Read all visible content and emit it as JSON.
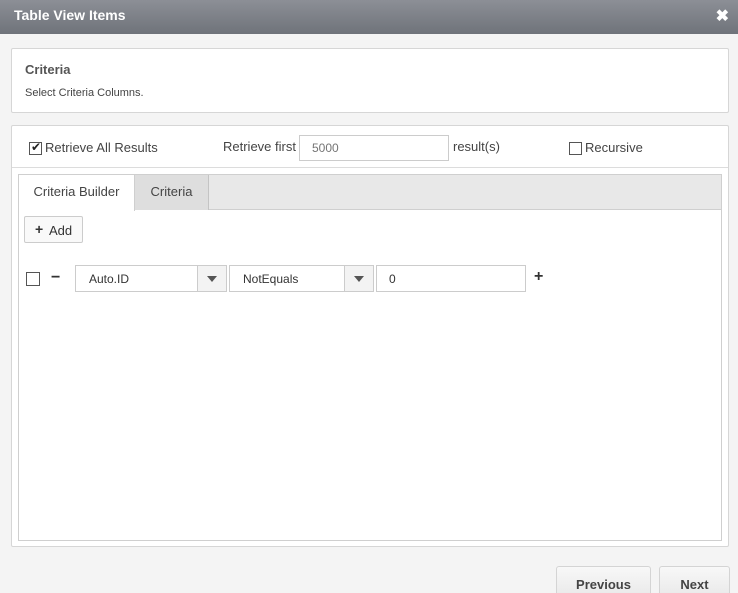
{
  "window": {
    "title": "Table View Items",
    "close_icon": "✖"
  },
  "criteria_panel": {
    "heading": "Criteria",
    "description": "Select Criteria Columns."
  },
  "options": {
    "retrieve_all_label": "Retrieve All Results",
    "retrieve_all_checked": true,
    "retrieve_first_label": "Retrieve first",
    "retrieve_first_placeholder": "5000",
    "results_suffix": "result(s)",
    "recursive_label": "Recursive",
    "recursive_checked": false
  },
  "tabs": [
    {
      "label": "Criteria Builder",
      "active": true
    },
    {
      "label": "Criteria",
      "active": false
    }
  ],
  "builder": {
    "add_label": "Add",
    "add_icon": "+",
    "rows": [
      {
        "field": "Auto.ID",
        "operator": "NotEquals",
        "value": "0",
        "minus_icon": "−",
        "plus_icon": "+"
      }
    ]
  },
  "footer": {
    "previous_label": "Previous",
    "next_label": "Next"
  }
}
